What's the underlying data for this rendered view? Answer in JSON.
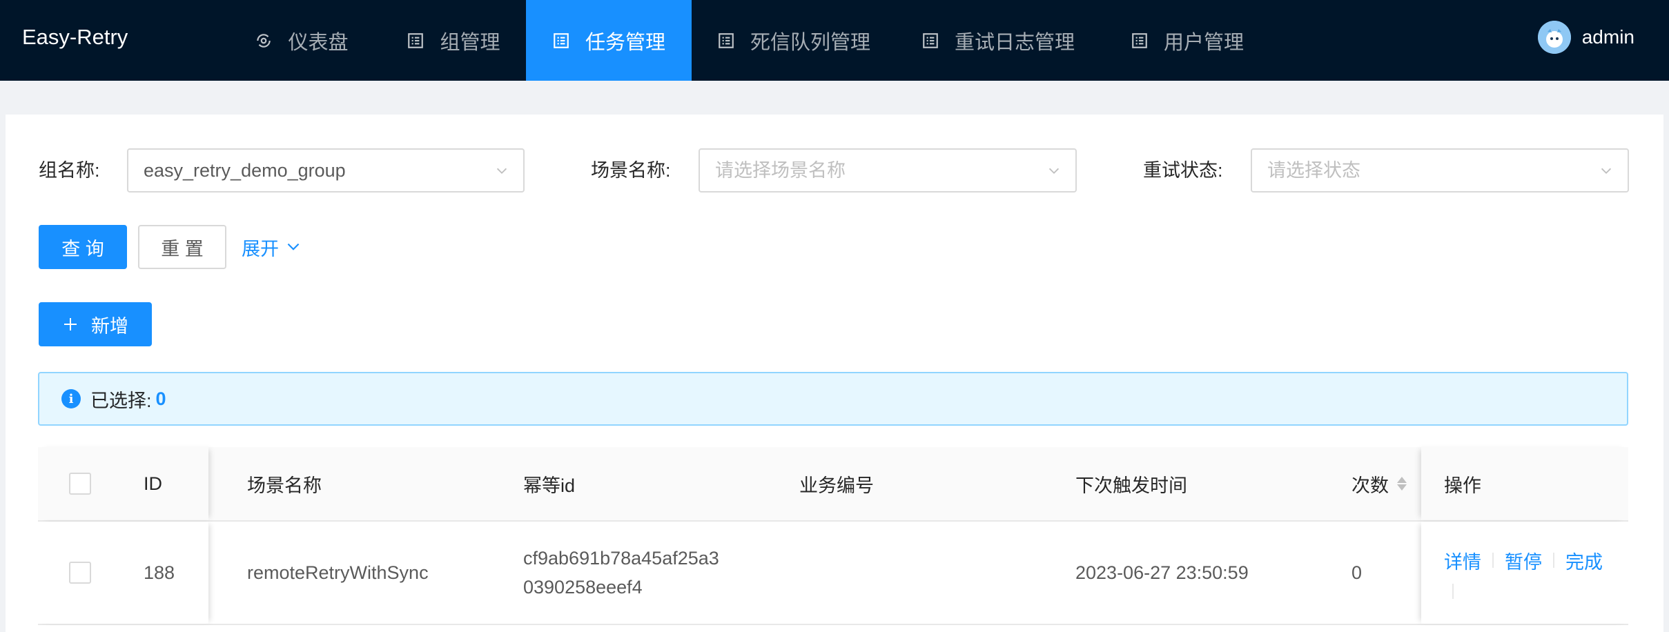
{
  "header": {
    "logo": "Easy-Retry",
    "nav": [
      {
        "label": "仪表盘",
        "icon": "dashboard-icon",
        "active": false
      },
      {
        "label": "组管理",
        "icon": "list-icon",
        "active": false
      },
      {
        "label": "任务管理",
        "icon": "list-icon",
        "active": true
      },
      {
        "label": "死信队列管理",
        "icon": "list-icon",
        "active": false
      },
      {
        "label": "重试日志管理",
        "icon": "list-icon",
        "active": false
      },
      {
        "label": "用户管理",
        "icon": "list-icon",
        "active": false
      }
    ],
    "user": {
      "name": "admin",
      "avatar_icon": "avatar-icon"
    }
  },
  "filters": {
    "group": {
      "label": "组名称:",
      "value": "easy_retry_demo_group"
    },
    "scene": {
      "label": "场景名称:",
      "placeholder": "请选择场景名称"
    },
    "status": {
      "label": "重试状态:",
      "placeholder": "请选择状态"
    }
  },
  "actions": {
    "query": "查 询",
    "reset": "重 置",
    "expand": "展开",
    "add": "新增"
  },
  "alert": {
    "label": "已选择:",
    "count": "0"
  },
  "table": {
    "columns": [
      "ID",
      "场景名称",
      "幂等id",
      "业务编号",
      "下次触发时间",
      "次数",
      "操作"
    ],
    "rows": [
      {
        "id": "188",
        "scene": "remoteRetryWithSync",
        "idempotent_line1": "cf9ab691b78a45af25a3",
        "idempotent_line2": "0390258eeef4",
        "biz_no": "",
        "next_trigger": "2023-06-27 23:50:59",
        "count": "0",
        "ops": [
          "详情",
          "暂停",
          "完成"
        ]
      }
    ]
  },
  "colors": {
    "header_bg": "#001529",
    "primary": "#1890ff",
    "alert_bg": "#e6f7ff",
    "alert_border": "#91d5ff"
  }
}
